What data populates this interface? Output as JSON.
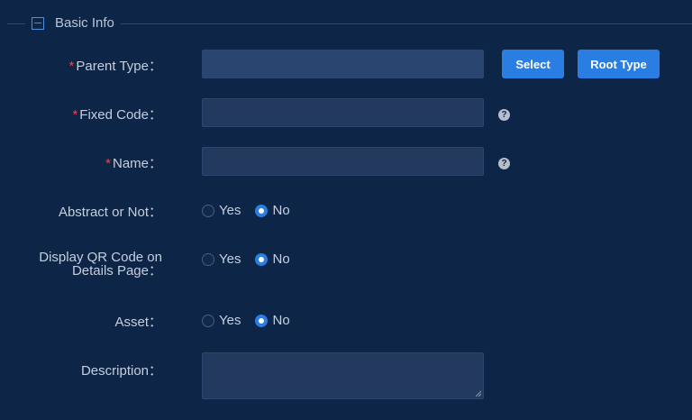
{
  "section": {
    "title": "Basic Info"
  },
  "form": {
    "parent_type": {
      "label": "Parent Type：",
      "required_mark": "*",
      "value": ""
    },
    "select_button": "Select",
    "root_type_button": "Root Type",
    "fixed_code": {
      "label": "Fixed Code：",
      "required_mark": "*",
      "value": ""
    },
    "name": {
      "label": "Name：",
      "required_mark": "*",
      "value": ""
    },
    "help_glyph": "?",
    "abstract": {
      "label": "Abstract or Not：",
      "options": [
        {
          "label": "Yes",
          "checked": false
        },
        {
          "label": "No",
          "checked": true
        }
      ]
    },
    "qr_code": {
      "label_line1": "Display QR Code on",
      "label_line2": "Details Page：",
      "options": [
        {
          "label": "Yes",
          "checked": false
        },
        {
          "label": "No",
          "checked": true
        }
      ]
    },
    "asset": {
      "label": "Asset：",
      "options": [
        {
          "label": "Yes",
          "checked": false
        },
        {
          "label": "No",
          "checked": true
        }
      ]
    },
    "description": {
      "label": "Description：",
      "value": ""
    }
  },
  "colors": {
    "background": "#0d2547",
    "primary": "#2a7de1",
    "required": "#e5484d"
  }
}
